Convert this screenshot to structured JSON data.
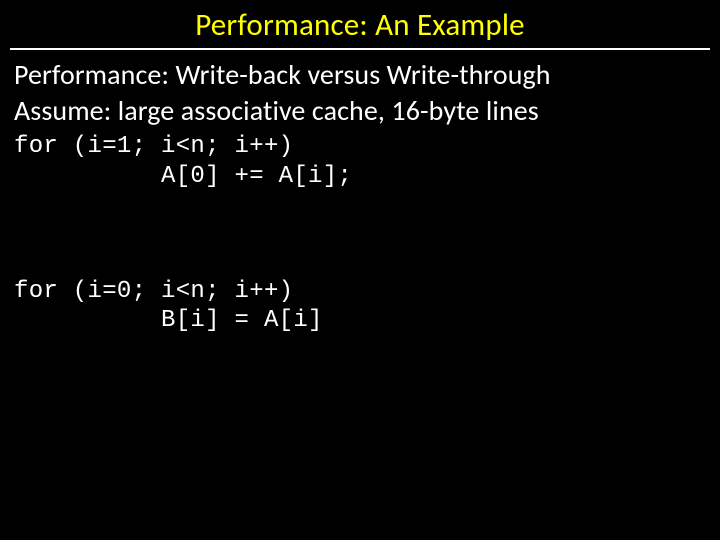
{
  "title": "Performance: An Example",
  "lead1": "Performance: Write-back versus Write-through",
  "lead2": "Assume: large associative cache, 16-byte lines",
  "code1": "for (i=1; i<n; i++)\n          A[0] += A[i];",
  "code2": "for (i=0; i<n; i++)\n          B[i] = A[i]"
}
